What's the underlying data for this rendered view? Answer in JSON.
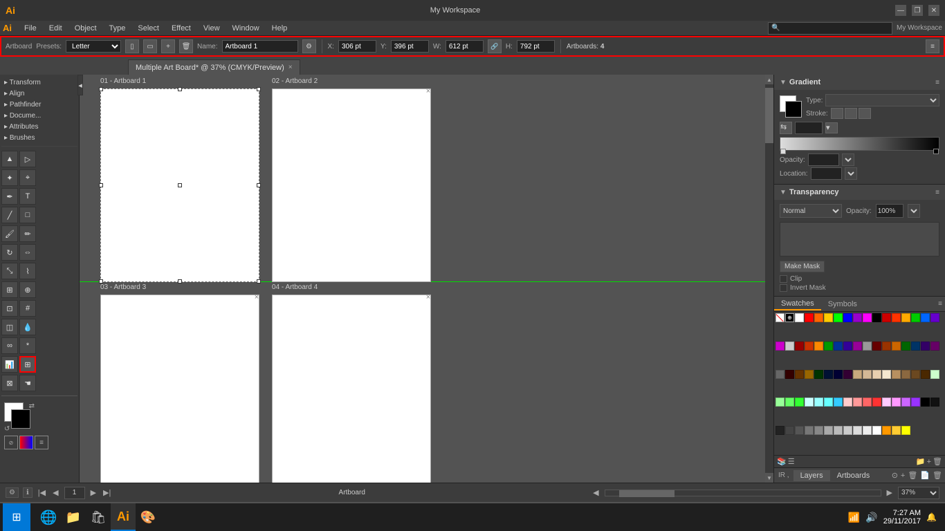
{
  "app": {
    "logo": "Ai",
    "title": "My Workspace"
  },
  "titlebar": {
    "title": "My Workspace",
    "minimize": "—",
    "restore": "❐",
    "close": "✕"
  },
  "menubar": {
    "items": [
      "File",
      "Edit",
      "Object",
      "Type",
      "Select",
      "Effect",
      "View",
      "Window",
      "Help"
    ]
  },
  "controlbar": {
    "preset_label": "Presets:",
    "preset_value": "Letter",
    "name_label": "Name:",
    "name_value": "Artboard 1",
    "x_label": "X:",
    "x_value": "306 pt",
    "y_label": "Y:",
    "y_value": "396 pt",
    "w_label": "W:",
    "w_value": "612 pt",
    "h_label": "H:",
    "h_value": "792 pt",
    "artboards_label": "Artboards:",
    "artboards_count": "4"
  },
  "tab": {
    "title": "Multiple Art Board* @ 37% (CMYK/Preview)",
    "close": "×"
  },
  "canvas": {
    "artboards": [
      {
        "id": "01",
        "label": "01 - Artboard 1",
        "col": 1,
        "row": 1,
        "selected": true
      },
      {
        "id": "02",
        "label": "02 - Artboard 2",
        "col": 2,
        "row": 1
      },
      {
        "id": "03",
        "label": "03 - Artboard 3",
        "col": 1,
        "row": 2
      },
      {
        "id": "04",
        "label": "04 - Artboard 4",
        "col": 2,
        "row": 2
      }
    ]
  },
  "panels": {
    "gradient": {
      "title": "Gradient",
      "type_label": "Type:",
      "type_value": "",
      "stroke_label": "Stroke:",
      "opacity_label": "Opacity:",
      "location_label": "Location:"
    },
    "transparency": {
      "title": "Transparency",
      "mode": "Normal",
      "opacity_label": "Opacity:",
      "opacity_value": "100%",
      "make_mask_btn": "Make Mask",
      "clip_label": "Clip",
      "invert_mask_label": "Invert Mask"
    },
    "swatches": {
      "title": "Swatches",
      "symbols_tab": "Symbols",
      "swatches_tab": "Swatches",
      "colors": [
        "#ffffff",
        "#ff0000",
        "#ff6600",
        "#ffcc00",
        "#00ff00",
        "#0000ff",
        "#9900cc",
        "#ff00ff",
        "#000000",
        "#cc0000",
        "#ff3300",
        "#ffaa00",
        "#00cc00",
        "#0066ff",
        "#6600cc",
        "#cc00cc",
        "#cccccc",
        "#990000",
        "#cc3300",
        "#ff8800",
        "#009900",
        "#003399",
        "#330099",
        "#990099",
        "#999999",
        "#660000",
        "#993300",
        "#cc6600",
        "#006600",
        "#003366",
        "#330066",
        "#660066",
        "#666666",
        "#330000",
        "#663300",
        "#996600",
        "#003300",
        "#001133",
        "#000033",
        "#330033",
        "#c8a87e",
        "#d4b896",
        "#e8d0b0",
        "#f5e8d0",
        "#b89060",
        "#8b6840",
        "#6b4820",
        "#4a2800",
        "#ccffcc",
        "#99ff99",
        "#66ff66",
        "#33ff33",
        "#ccffff",
        "#99ffff",
        "#66ffff",
        "#33ccff",
        "#ffcccc",
        "#ff9999",
        "#ff6666",
        "#ff3333",
        "#ffccff",
        "#ff99ff",
        "#cc66ff",
        "#9933ff",
        "#000000",
        "#111111",
        "#222222",
        "#444444",
        "#555555",
        "#777777",
        "#888888",
        "#aaaaaa",
        "#bbbbbb",
        "#cccccc",
        "#dddddd",
        "#eeeeee",
        "#ffffff",
        "#ff9900",
        "#ffcc33",
        "#ffff00"
      ]
    }
  },
  "left_panels": [
    {
      "id": "transform",
      "label": "Transform"
    },
    {
      "id": "align",
      "label": "Align"
    },
    {
      "id": "pathfinder",
      "label": "Pathfinder"
    },
    {
      "id": "document",
      "label": "Docume..."
    },
    {
      "id": "attributes",
      "label": "Attributes"
    },
    {
      "id": "brushes",
      "label": "Brushes"
    }
  ],
  "statusbar": {
    "zoom": "37%",
    "artboard_label": "Artboard",
    "page_num": "1"
  },
  "bottom_tabs": {
    "ir_label": "IR ,",
    "layers_tab": "Layers",
    "artboards_tab": "Artboards"
  },
  "taskbar": {
    "time": "7:27 AM",
    "date": "29/11/2017",
    "start_icon": "⊞"
  }
}
